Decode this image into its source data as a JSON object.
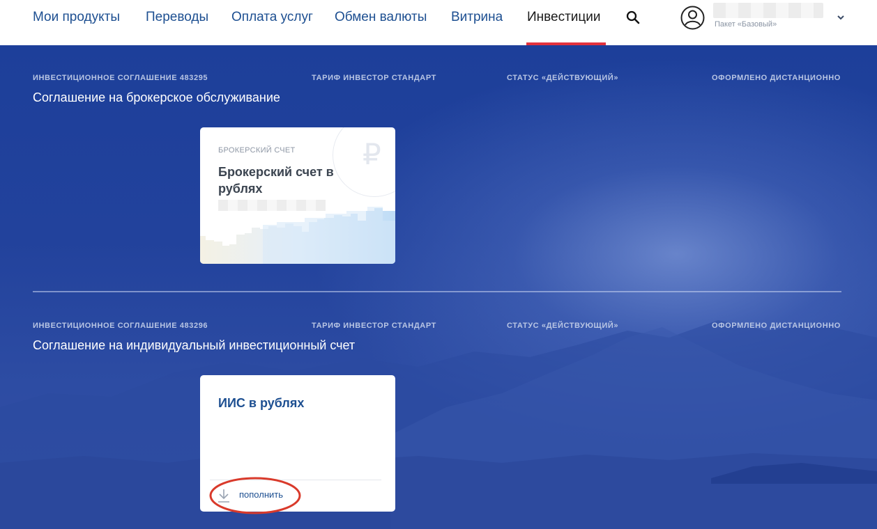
{
  "nav": {
    "items": [
      {
        "label": "Мои продукты"
      },
      {
        "label": "Переводы"
      },
      {
        "label": "Оплата услуг"
      },
      {
        "label": "Обмен валюты"
      },
      {
        "label": "Витрина"
      },
      {
        "label": "Инвестиции",
        "active": true
      }
    ],
    "search_icon": "search-icon",
    "user": {
      "avatar_icon": "user-circle-icon",
      "package": "Пакет «Базовый»",
      "menu_icon": "chevron-down-icon"
    }
  },
  "agreements": [
    {
      "number_label": "ИНВЕСТИЦИОННОЕ СОГЛАШЕНИЕ 483295",
      "tariff": "ТАРИФ ИНВЕСТОР СТАНДАРТ",
      "status": "СТАТУС «ДЕЙСТВУЮЩИЙ»",
      "channel": "ОФОРМЛЕНО ДИСТАНЦИОННО",
      "title": "Соглашение на брокерское обслуживание",
      "card": {
        "kicker": "БРОКЕРСКИЙ СЧЕТ",
        "title": "Брокерский счет в рублях",
        "currency_icon": "ruble-icon",
        "currency_symbol": "₽"
      }
    },
    {
      "number_label": "ИНВЕСТИЦИОННОЕ СОГЛАШЕНИЕ 483296",
      "tariff": "ТАРИФ ИНВЕСТОР СТАНДАРТ",
      "status": "СТАТУС «ДЕЙСТВУЮЩИЙ»",
      "channel": "ОФОРМЛЕНО ДИСТАНЦИОННО",
      "title": "Соглашение на индивидуальный инвестиционный счет",
      "card": {
        "title": "ИИС в рублях",
        "action_label": "пополнить",
        "action_icon": "download-arrow-icon"
      }
    }
  ],
  "colors": {
    "brand_blue": "#1d4f91",
    "active_underline": "#e2323d",
    "annotation": "#d93a2b"
  }
}
